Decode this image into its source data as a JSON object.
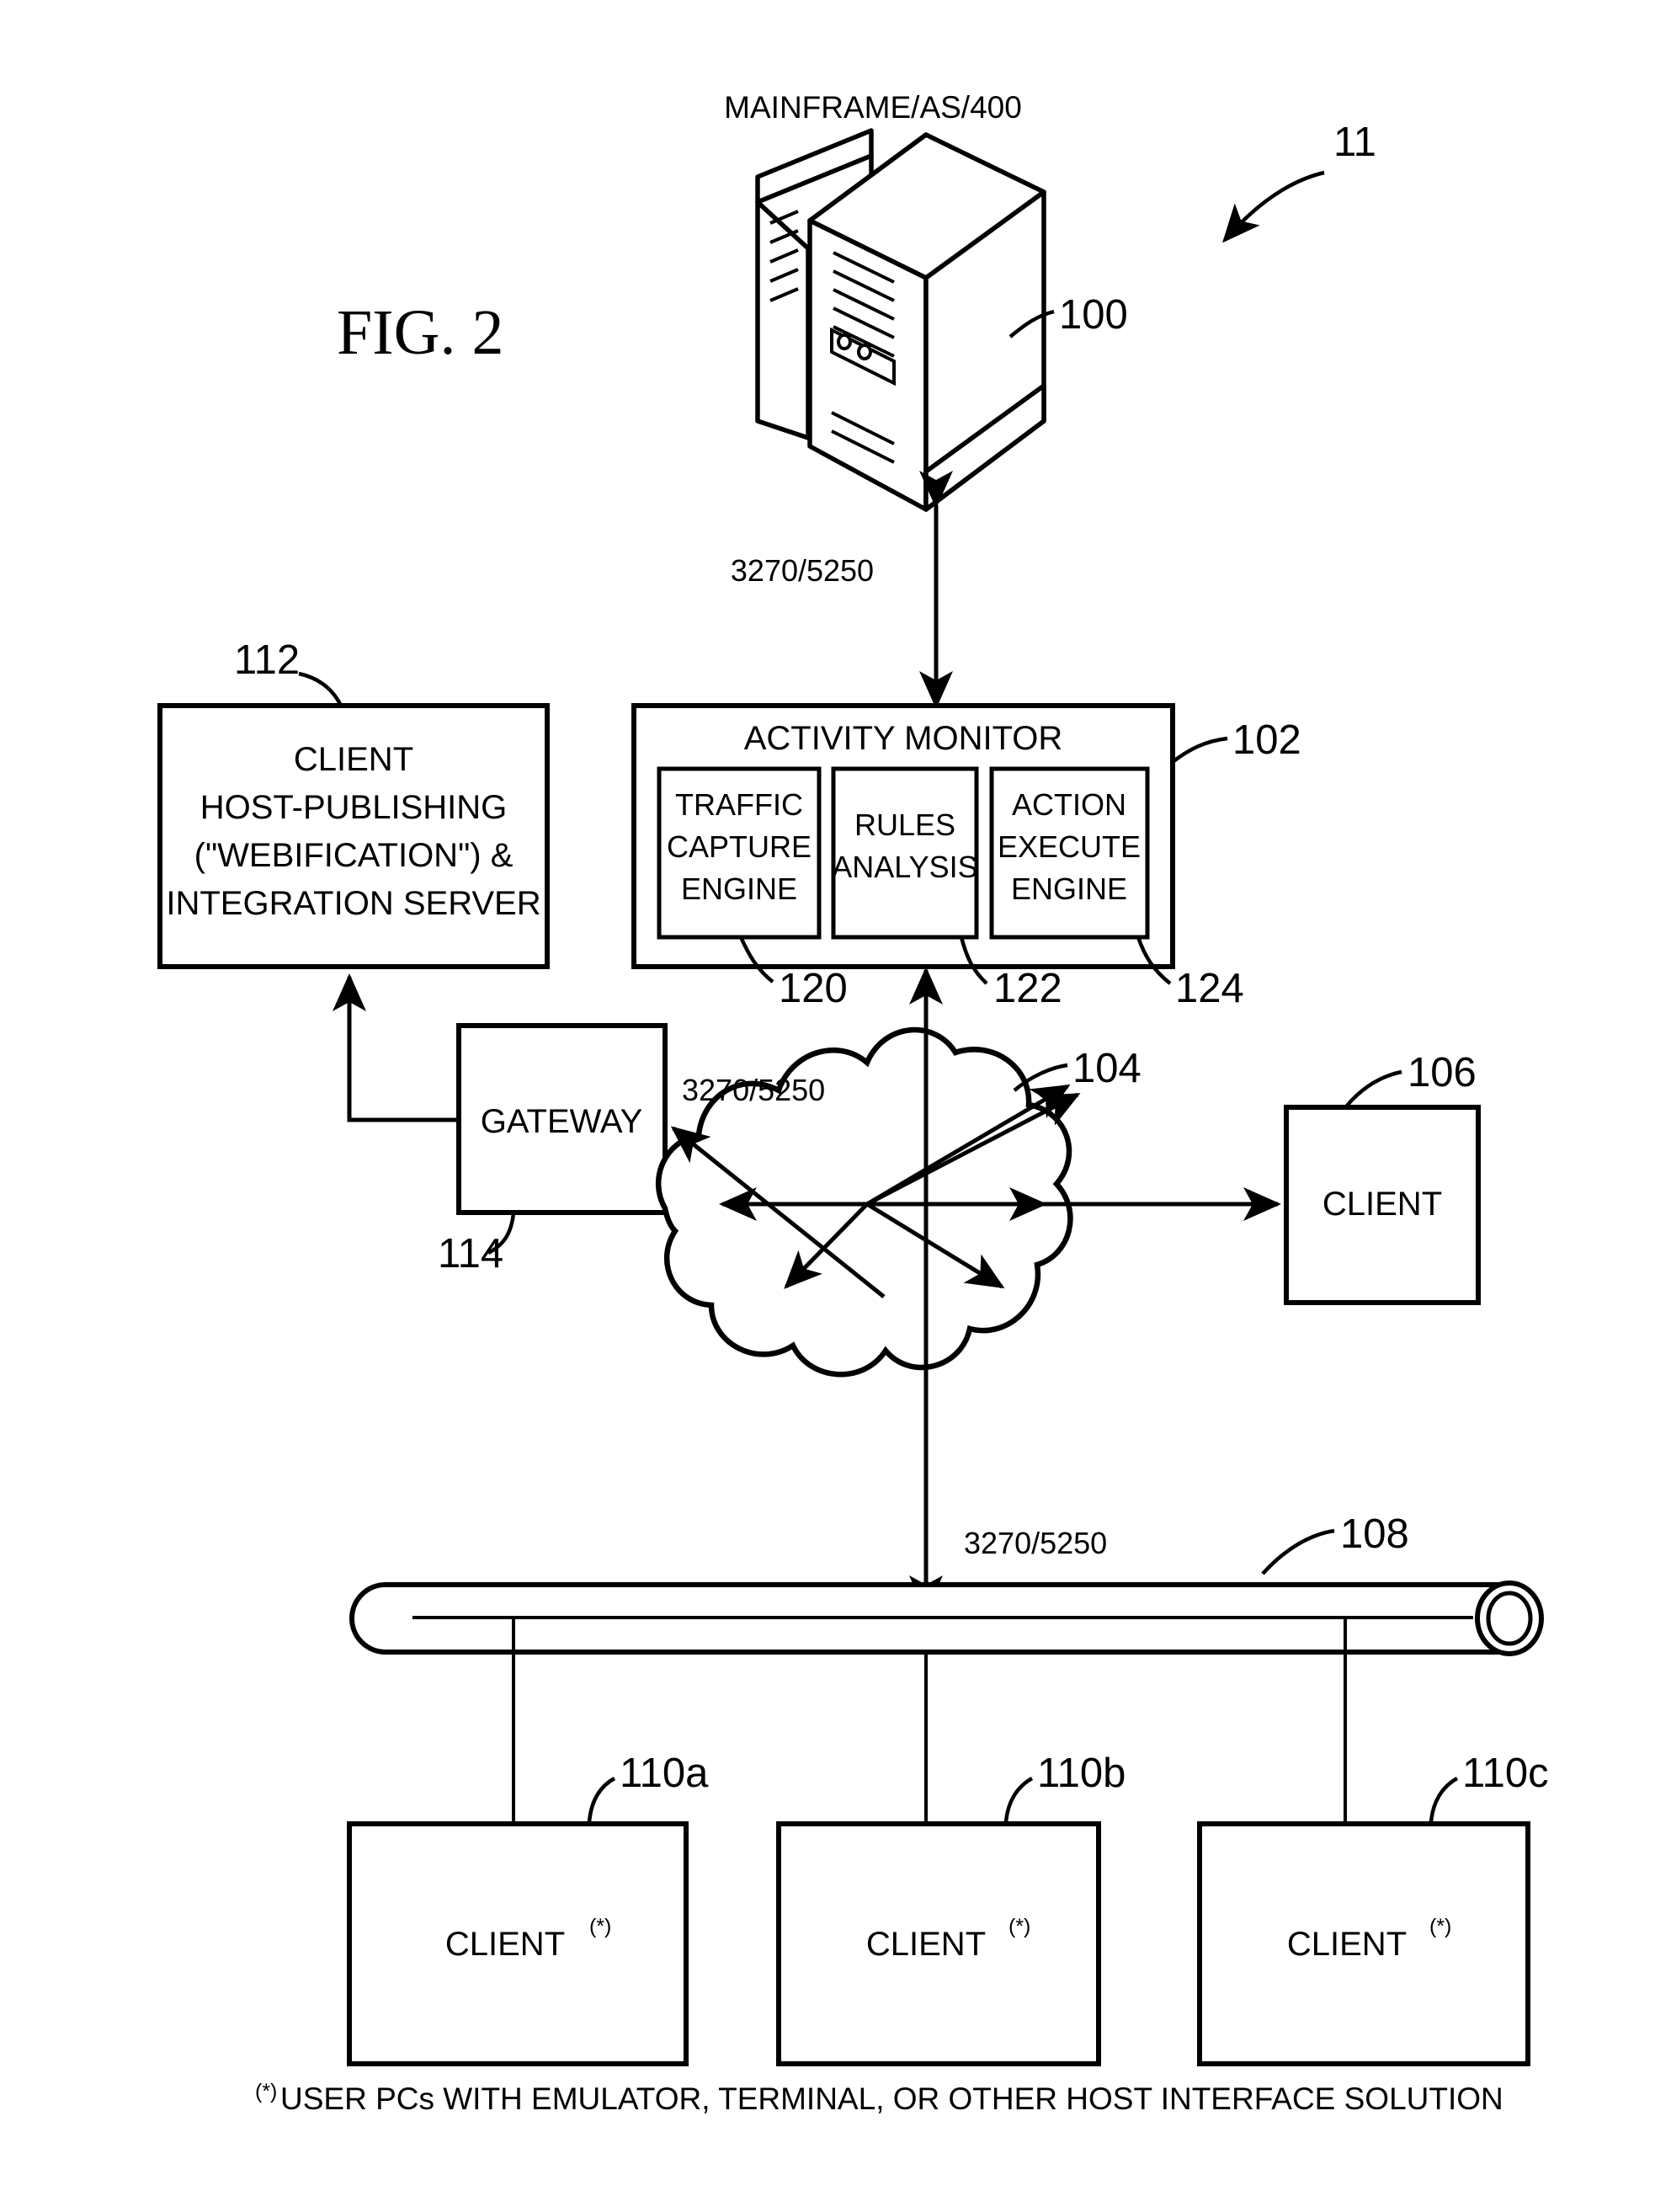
{
  "figure": {
    "caption": "FIG. 2",
    "system_ref": "11"
  },
  "nodes": {
    "mainframe": {
      "label": "MAINFRAME/AS/400",
      "ref": "100",
      "icon": "server-tower-icon"
    },
    "activity_monitor": {
      "title": "ACTIVITY MONITOR",
      "ref": "102",
      "sub_blocks": [
        {
          "label_lines": [
            "TRAFFIC",
            "CAPTURE",
            "ENGINE"
          ],
          "ref": "120"
        },
        {
          "label_lines": [
            "RULES",
            "ANALYSIS"
          ],
          "ref": "122"
        },
        {
          "label_lines": [
            "ACTION",
            "EXECUTE",
            "ENGINE"
          ],
          "ref": "124"
        }
      ]
    },
    "integration_server": {
      "label_lines": [
        "CLIENT",
        "HOST-PUBLISHING",
        "(\"WEBIFICATION\") &",
        "INTEGRATION SERVER"
      ],
      "ref": "112"
    },
    "gateway": {
      "label": "GATEWAY",
      "ref": "114"
    },
    "network_cloud": {
      "ref": "104",
      "icon": "cloud-icon"
    },
    "client_direct": {
      "label": "CLIENT",
      "ref": "106"
    },
    "bus": {
      "ref": "108",
      "icon": "network-bus-cylinder-icon"
    },
    "bus_clients": [
      {
        "label": "CLIENT",
        "superscript": "(*)",
        "ref": "110a"
      },
      {
        "label": "CLIENT",
        "superscript": "(*)",
        "ref": "110b"
      },
      {
        "label": "CLIENT",
        "superscript": "(*)",
        "ref": "110c"
      }
    ]
  },
  "connections": [
    {
      "label": "3270/5250",
      "from": "activity_monitor",
      "to": "mainframe",
      "style": "double-arrow"
    },
    {
      "label": "3270/5250",
      "from": "network_cloud",
      "to": "gateway",
      "style": "single-arrow"
    },
    {
      "label": "3270/5250",
      "from": "network_cloud",
      "to": "bus",
      "style": "single-arrow"
    }
  ],
  "footnote": {
    "marker": "(*)",
    "text": "USER PCs WITH EMULATOR, TERMINAL, OR OTHER HOST INTERFACE SOLUTION"
  },
  "colors": {
    "ink": "#000000",
    "paper": "#ffffff"
  }
}
